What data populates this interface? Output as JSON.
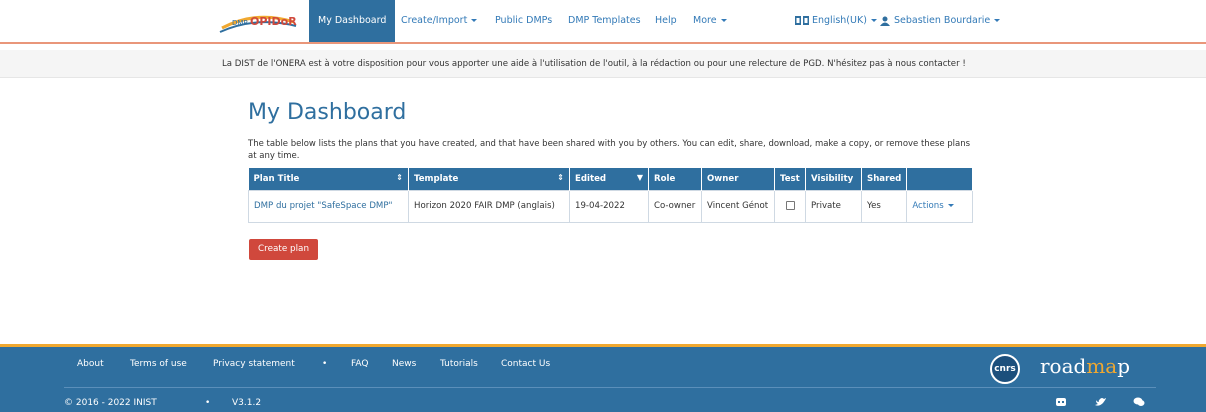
{
  "navbar": {
    "logo_text": "DMP OPIDoR",
    "items": [
      {
        "label": "My Dashboard",
        "active": true
      },
      {
        "label": "Create/Import"
      },
      {
        "label": "Public DMPs"
      },
      {
        "label": "DMP Templates"
      },
      {
        "label": "Help"
      },
      {
        "label": "More"
      }
    ],
    "language": "English(UK)",
    "user": "Sebastien Bourdarie"
  },
  "notice": "La DIST de l'ONERA est à votre disposition pour vous apporter une aide à l'utilisation de l'outil, à la rédaction ou pour une relecture de PGD. N'hésitez pas à nous contacter !",
  "main": {
    "title": "My Dashboard",
    "intro": "The table below lists the plans that you have created, and that have been shared with you by others. You can edit, share, download, make a copy, or remove these plans at any time.",
    "table": {
      "headers": [
        "Plan Title",
        "Template",
        "Edited",
        "Role",
        "Owner",
        "Test",
        "Visibility",
        "Shared",
        ""
      ],
      "rows": [
        {
          "plan_title": "DMP du projet \"SafeSpace DMP\"",
          "template": "Horizon 2020 FAIR DMP (anglais)",
          "edited": "19-04-2022",
          "role": "Co-owner",
          "owner": "Vincent Génot",
          "test": false,
          "visibility": "Private",
          "shared": "Yes",
          "actions": "Actions"
        }
      ]
    },
    "create_button": "Create plan"
  },
  "footer": {
    "links": [
      "About",
      "Terms of use",
      "Privacy statement",
      "FAQ",
      "News",
      "Tutorials",
      "Contact Us"
    ],
    "copyright": "© 2016 - 2022 INIST",
    "version": "V3.1.2",
    "cnrs_logo": "cnrs",
    "roadmap_logo_part1": "road",
    "roadmap_logo_part2": "map",
    "roadmap_logo_accent": "ma",
    "social_icons": [
      "github-icon",
      "twitter-icon",
      "chat-icon"
    ]
  },
  "colors": {
    "primary": "#2f6f9f",
    "link": "#337ab7",
    "create_button": "#d0483c",
    "footer_accent": "#f0a830",
    "navbar_border": "#e9967a"
  }
}
